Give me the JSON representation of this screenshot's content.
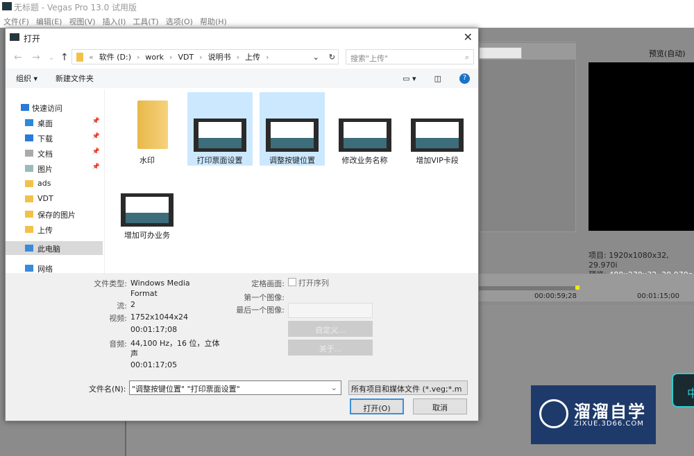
{
  "app": {
    "title": "无标题 - Vegas Pro 13.0 试用版",
    "menu": [
      "文件(F)",
      "编辑(E)",
      "视图(V)",
      "插入(I)",
      "工具(T)",
      "选项(O)",
      "帮助(H)"
    ],
    "preview_label": "预览(自动)",
    "project_label": "项目:",
    "project_value": "1920x1080x32, 29.970i",
    "preview_info_label": "预览:",
    "preview_info_value": "480x270x32, 29.970p",
    "timecodes": [
      "00:00:59;28",
      "00:01:15;00"
    ]
  },
  "dialog": {
    "title": "打开",
    "path": [
      "软件 (D:)",
      "work",
      "VDT",
      "说明书",
      "上传"
    ],
    "search_placeholder": "搜索\"上传\"",
    "toolbar": {
      "organize": "组织 ▾",
      "new_folder": "新建文件夹"
    },
    "sidebar": [
      {
        "label": "快速访问",
        "icon": "star-icon"
      },
      {
        "label": "桌面",
        "icon": "desktop-icon",
        "pinned": true
      },
      {
        "label": "下载",
        "icon": "download-icon",
        "pinned": true
      },
      {
        "label": "文档",
        "icon": "document-icon",
        "pinned": true
      },
      {
        "label": "图片",
        "icon": "pictures-icon",
        "pinned": true
      },
      {
        "label": "ads",
        "icon": "folder-icon"
      },
      {
        "label": "VDT",
        "icon": "folder-icon"
      },
      {
        "label": "保存的图片",
        "icon": "folder-icon"
      },
      {
        "label": "上传",
        "icon": "folder-icon"
      },
      {
        "label": "此电脑",
        "icon": "computer-icon",
        "selected": true
      },
      {
        "label": "网络",
        "icon": "network-icon"
      }
    ],
    "files": [
      {
        "name": "水印",
        "type": "folder"
      },
      {
        "name": "打印票面设置",
        "type": "video",
        "selected": true
      },
      {
        "name": "调整按键位置",
        "type": "video",
        "selected": true
      },
      {
        "name": "修改业务名称",
        "type": "video"
      },
      {
        "name": "增加VIP卡段",
        "type": "video"
      },
      {
        "name": "增加可办业务",
        "type": "video"
      }
    ],
    "details": {
      "file_type_label": "文件类型:",
      "file_type": "Windows Media Format",
      "streams_label": "流:",
      "streams": "2",
      "video_label": "视频:",
      "video": "1752x1044x24",
      "video_duration": "00:01:17;08",
      "audio_label": "音频:",
      "audio": "44,100 Hz，16 位，立体声",
      "audio_duration": "00:01:17;05",
      "still_label": "定格画面:",
      "open_sequence": "打开序列",
      "first_image": "第一个图像:",
      "last_image": "最后一个图像:",
      "custom": "自定义...",
      "about": "关于..."
    },
    "filename_label": "文件名(N):",
    "filename": "\"调整按键位置\" \"打印票面设置\"",
    "filetype": "所有项目和媒体文件 (*.veg;*.m",
    "open": "打开(O)",
    "cancel": "取消"
  },
  "watermark": {
    "title": "溜溜自学",
    "url": "ZIXUE.3D66.COM"
  },
  "ime": "中"
}
